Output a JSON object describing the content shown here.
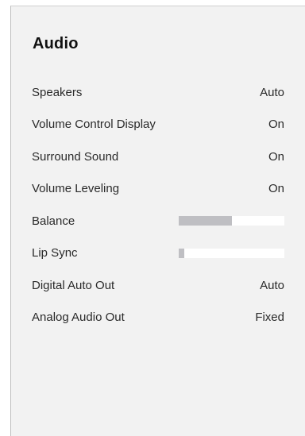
{
  "panel": {
    "title": "Audio"
  },
  "settings": [
    {
      "label": "Speakers",
      "value": "Auto"
    },
    {
      "label": "Volume Control Display",
      "value": "On"
    },
    {
      "label": "Surround Sound",
      "value": "On"
    },
    {
      "label": "Volume Leveling",
      "value": "On"
    },
    {
      "label": "Balance",
      "level_fraction": 0.5
    },
    {
      "label": "Lip Sync",
      "level_fraction": 0.05
    },
    {
      "label": "Digital Auto Out",
      "value": "Auto"
    },
    {
      "label": "Analog Audio Out",
      "value": "Fixed"
    }
  ],
  "colors": {
    "panel_background": "#f2f2f2",
    "text": "#2a2a2a",
    "slider_track": "#ffffff",
    "slider_fill": "#bfbfc3"
  }
}
